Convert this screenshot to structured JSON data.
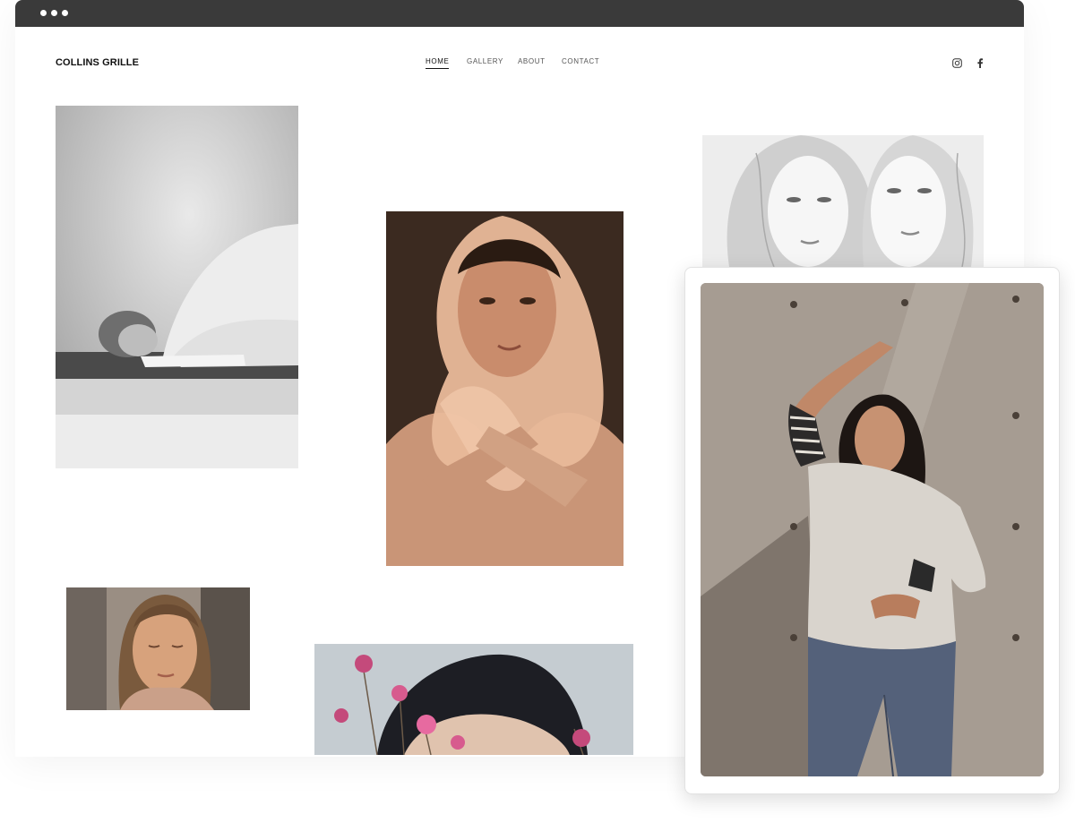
{
  "site": {
    "title": "COLLINS GRILLE"
  },
  "nav": {
    "items": [
      "HOME",
      "GALLERY",
      "ABOUT",
      "CONTACT"
    ],
    "active": "HOME"
  },
  "social": {
    "icons": [
      "instagram-icon",
      "facebook-icon"
    ]
  },
  "colors": {
    "titlebar": "#3a3a3a",
    "text": "#111111",
    "nav_text": "#555555"
  }
}
